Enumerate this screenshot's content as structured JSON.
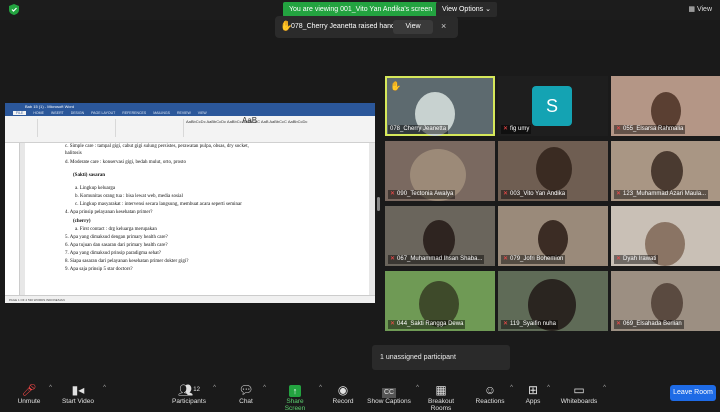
{
  "topbar": {
    "viewing_text": "You are viewing 001_Vito Yan Andika's screen",
    "view_options": "View Options",
    "view_label": "View"
  },
  "notification": {
    "text": "078_Cherry Jeanetta raised hand",
    "view_button": "View",
    "close": "×"
  },
  "shared_doc": {
    "window_title": "Bab 15 (1) - Microsoft Word",
    "tabs": [
      "FILE",
      "HOME",
      "INSERT",
      "DESIGN",
      "PAGE LAYOUT",
      "REFERENCES",
      "MAILINGS",
      "REVIEW",
      "VIEW"
    ],
    "styles_text": "AaBbCcDc AaBbCcDc AaBbCc AaBbCcC AaB AaBbCcC AaBbCcDc",
    "big_style": "AaB",
    "lines": [
      "c.   Simple care : tampal gigi, cabut gigi sulung persistes, perawatan pulpa, obsas, dry socket,",
      "      halitosis",
      "d.   Moderate care : konservasi gigi, bedah mulut, orto, prosto",
      "(Sakti) sasaran",
      "a.   Lingkup keluarga",
      "b.   Komunitas orang tua : bisa lewat web, media sosial",
      "c.   Lingkup masyarakat : intervensi secara langsung, membuat acara seperti seminar",
      "4.   Apa prinsip pelayanan kesehatan primer?",
      "(cherry)",
      "a.   First contact : drg keluarga merupakan",
      "5.   Apa yang dimaksud dengan primary health care?",
      "6.   Apa tujuan dan sasaran dari primary health care?",
      "7.   Apa yang dimaksud prinsip paradigma sehat?",
      "8.   Siapa sasaran dari pelayanan kesehatan primer dokter gigi?",
      "9.   Apa saja prinsip 5 star doctors?"
    ],
    "status_text": "PAGE 1 OF 2   530 WORDS   INDONESIAN"
  },
  "participants_tiles": [
    {
      "name": "078_Cherry Jeanetta",
      "muted": false,
      "bg": "#5d6a6f"
    },
    {
      "name": "fig umy",
      "muted": true,
      "bg": "#1e1e1e"
    },
    {
      "name": "055_Elsarsa Rahmalia",
      "muted": true,
      "bg": "#b49686"
    },
    {
      "name": "090_Tectonia Awalya",
      "muted": true,
      "bg": "#7a6960"
    },
    {
      "name": "003_Vito Yan Andika",
      "muted": true,
      "bg": "#6f5e52"
    },
    {
      "name": "123_Muhammad Azari Maula...",
      "muted": true,
      "bg": "#a99684"
    },
    {
      "name": "067_Muhammad Ihsan Shaba...",
      "muted": true,
      "bg": "#6a655c"
    },
    {
      "name": "079_Jofri Bohemion",
      "muted": true,
      "bg": "#9a8a7a"
    },
    {
      "name": "Dyah Irawati",
      "muted": true,
      "bg": "#c9c0b6"
    },
    {
      "name": "044_Sakti Rangga Dewa",
      "muted": true,
      "bg": "#6f9a55"
    },
    {
      "name": "119_Syaifin nuha",
      "muted": true,
      "bg": "#5f6b57"
    },
    {
      "name": "069_Elsahada Berlian",
      "muted": true,
      "bg": "#9c8f82"
    }
  ],
  "avatar_letter": "S",
  "unassigned": "1 unassigned participant",
  "toolbar": {
    "unmute": "Unmute",
    "start_video": "Start Video",
    "participants": "Participants",
    "participants_count": "12",
    "chat": "Chat",
    "share_screen": "Share Screen",
    "record": "Record",
    "show_captions": "Show Captions",
    "breakout_rooms": "Breakout Rooms",
    "reactions": "Reactions",
    "apps": "Apps",
    "whiteboards": "Whiteboards",
    "leave": "Leave Room"
  },
  "colors": {
    "green": "#23a340",
    "leave_blue": "#1e6be6",
    "word_blue": "#2b579a",
    "muted_red": "#ff4a4a",
    "active_speaker": "#d6e85a"
  }
}
